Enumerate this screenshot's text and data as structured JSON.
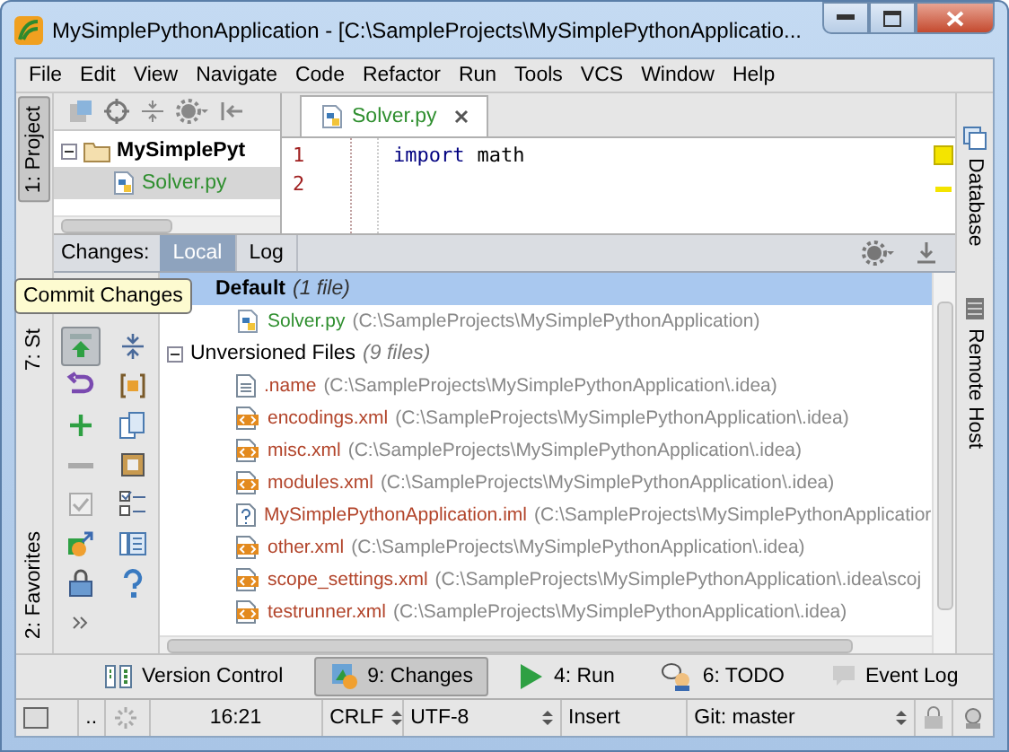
{
  "window": {
    "title": "MySimplePythonApplication - [C:\\SampleProjects\\MySimplePythonApplicatio..."
  },
  "menu": [
    "File",
    "Edit",
    "View",
    "Navigate",
    "Code",
    "Refactor",
    "Run",
    "Tools",
    "VCS",
    "Window",
    "Help"
  ],
  "left_tabs": [
    {
      "label": "1: Project",
      "selected": true
    },
    {
      "label": "7: St",
      "selected": false
    },
    {
      "label": "2: Favorites",
      "selected": false
    }
  ],
  "project_tree": [
    {
      "label": "MySimplePyt",
      "kind": "folder",
      "selected": false
    },
    {
      "label": "Solver.py",
      "kind": "python",
      "selected": true
    }
  ],
  "editor": {
    "tab": "Solver.py",
    "lines": [
      {
        "number": "1",
        "tokens": [
          {
            "text": "import",
            "kind": "keyword"
          },
          {
            "text": "math",
            "kind": "name"
          }
        ]
      },
      {
        "number": "2"
      }
    ]
  },
  "right_tabs": [
    "Database",
    "Remote Host"
  ],
  "changes": {
    "title": "Changes:",
    "tabs": [
      {
        "label": "Local",
        "selected": true
      },
      {
        "label": "Log",
        "selected": false
      }
    ],
    "commit_pressed": true,
    "tooltip": "Commit Changes",
    "groups": [
      {
        "label": "Default",
        "count": "(1 file)",
        "default": true,
        "selected": true,
        "expanded": true,
        "files": [
          {
            "name": "Solver.py",
            "path": "(C:\\SampleProjects\\MySimplePythonApplication)",
            "kind": "python",
            "color": "#2f8f2f"
          }
        ]
      },
      {
        "label": "Unversioned Files",
        "count": "(9 files)",
        "default": false,
        "selected": false,
        "expanded": true,
        "files": [
          {
            "name": ".name",
            "path": "(C:\\SampleProjects\\MySimplePythonApplication\\.idea)",
            "kind": "text",
            "color": "#b2442a"
          },
          {
            "name": "encodings.xml",
            "path": "(C:\\SampleProjects\\MySimplePythonApplication\\.idea)",
            "kind": "xml",
            "color": "#b2442a"
          },
          {
            "name": "misc.xml",
            "path": "(C:\\SampleProjects\\MySimplePythonApplication\\.idea)",
            "kind": "xml",
            "color": "#b2442a"
          },
          {
            "name": "modules.xml",
            "path": "(C:\\SampleProjects\\MySimplePythonApplication\\.idea)",
            "kind": "xml",
            "color": "#b2442a"
          },
          {
            "name": "MySimplePythonApplication.iml",
            "path": "(C:\\SampleProjects\\MySimplePythonApplicatior",
            "kind": "unknown",
            "color": "#b2442a"
          },
          {
            "name": "other.xml",
            "path": "(C:\\SampleProjects\\MySimplePythonApplication\\.idea)",
            "kind": "xml",
            "color": "#b2442a"
          },
          {
            "name": "scope_settings.xml",
            "path": "(C:\\SampleProjects\\MySimplePythonApplication\\.idea\\scoj",
            "kind": "xml",
            "color": "#b2442a"
          },
          {
            "name": "testrunner.xml",
            "path": "(C:\\SampleProjects\\MySimplePythonApplication\\.idea)",
            "kind": "xml",
            "color": "#b2442a"
          }
        ]
      }
    ]
  },
  "tool_windows": [
    {
      "label": "Version Control",
      "kind": "vcs",
      "selected": false
    },
    {
      "label": "9: Changes",
      "kind": "changes",
      "selected": true
    },
    {
      "label": "4: Run",
      "kind": "run",
      "selected": false
    },
    {
      "label": "6: TODO",
      "kind": "todo",
      "selected": false
    }
  ],
  "event_log": "Event Log",
  "status_bar": {
    "more": "..",
    "time": "16:21",
    "line_separator": "CRLF",
    "encoding": "UTF-8",
    "mode": "Insert",
    "branch": "Git: master"
  }
}
